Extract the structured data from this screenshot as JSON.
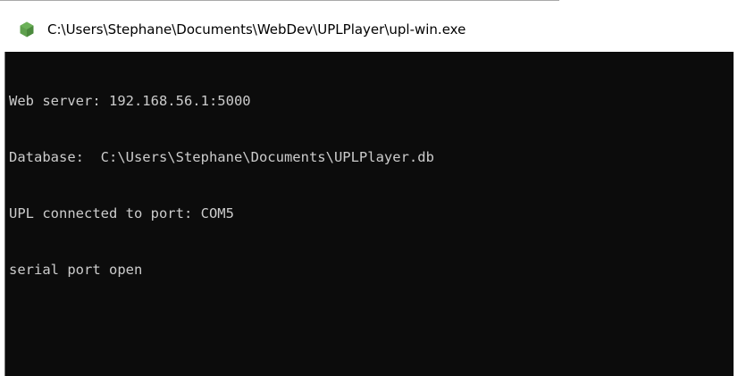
{
  "window": {
    "title": "C:\\Users\\Stephane\\Documents\\WebDev\\UPLPlayer\\upl-win.exe",
    "icon": "nodejs-hexagon-icon",
    "icon_color": "#5fa04e"
  },
  "console": {
    "background": "#0c0c0c",
    "foreground": "#cccccc",
    "lines": [
      "Web server: 192.168.56.1:5000",
      "Database:  C:\\Users\\Stephane\\Documents\\UPLPlayer.db",
      "UPL connected to port: COM5",
      "serial port open"
    ]
  }
}
